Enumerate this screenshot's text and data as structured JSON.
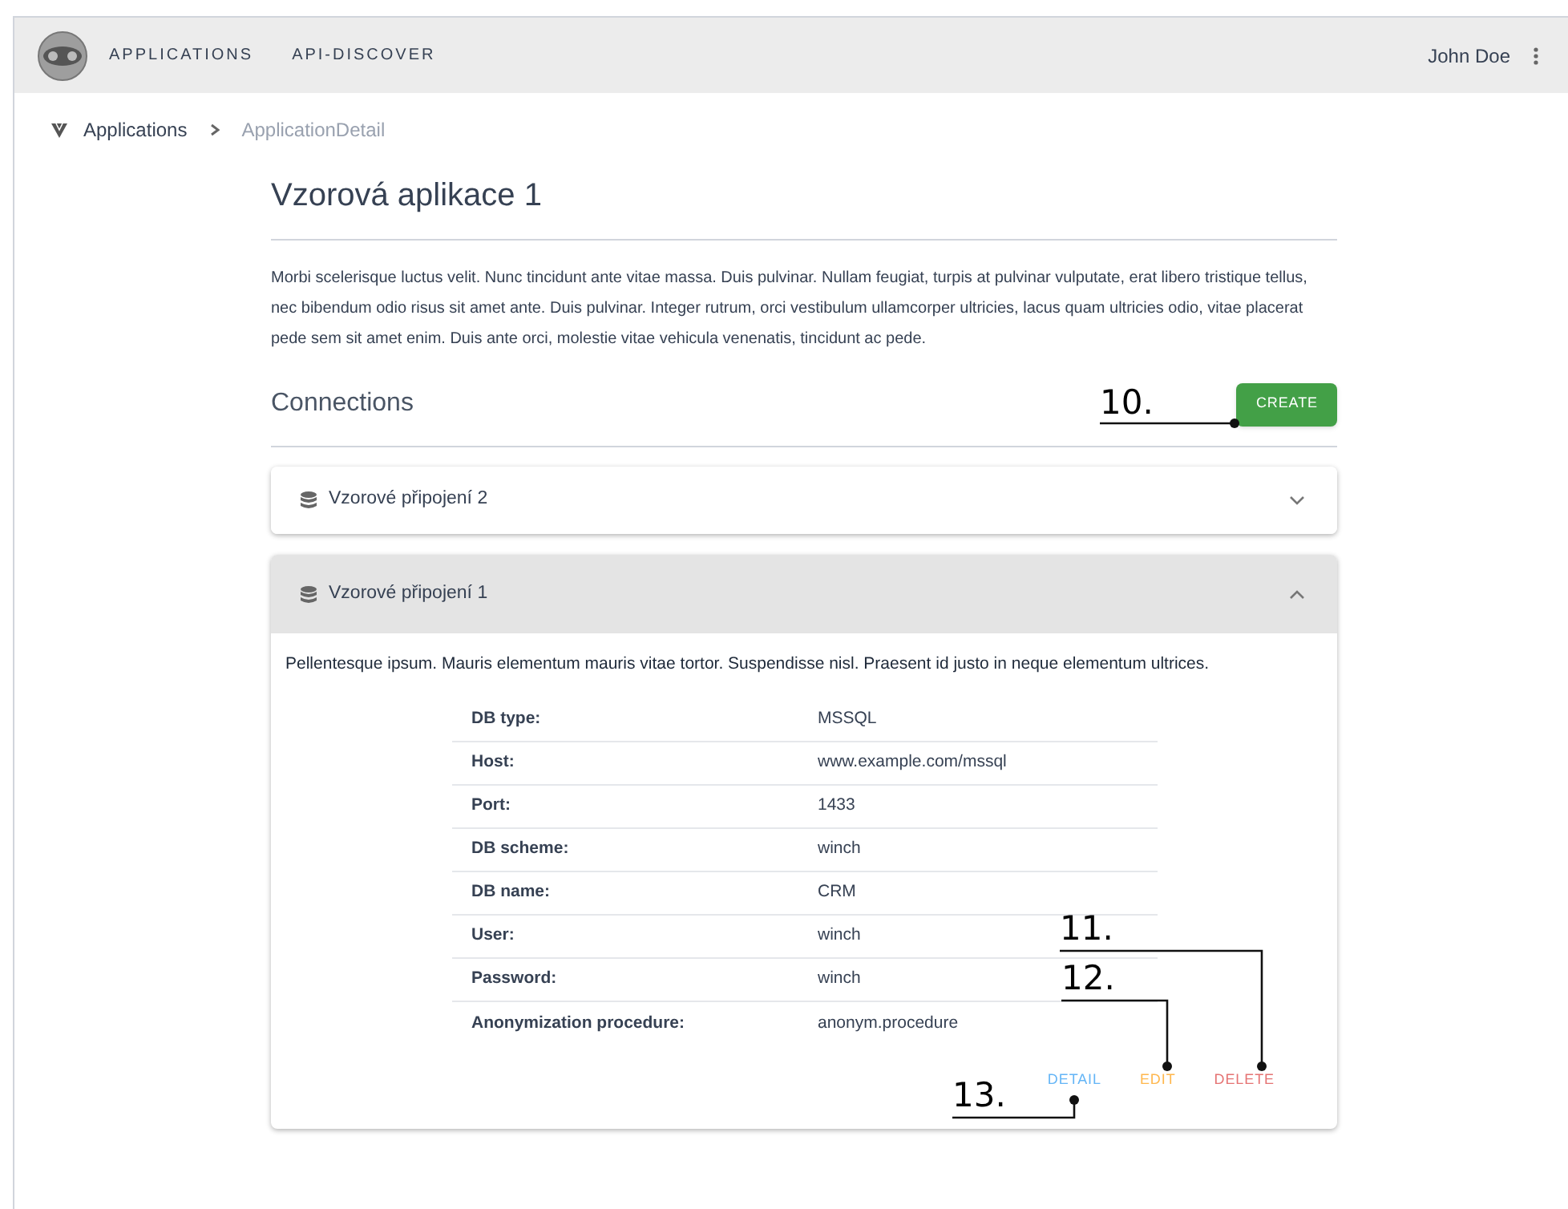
{
  "navbar": {
    "items": [
      {
        "label": "APPLICATIONS"
      },
      {
        "label": "API-DISCOVER"
      }
    ],
    "user": "John Doe"
  },
  "breadcrumb": [
    {
      "label": "Applications",
      "current": false
    },
    {
      "label": "ApplicationDetail",
      "current": true
    }
  ],
  "title": "Vzorová aplikace 1",
  "description": "Morbi scelerisque luctus velit. Nunc tincidunt ante vitae massa. Duis pulvinar. Nullam feugiat, turpis at pulvinar vulputate, erat libero tristique tellus, nec bibendum odio risus sit amet ante. Duis pulvinar. Integer rutrum, orci vestibulum ullamcorper ultricies, lacus quam ultricies odio, vitae placerat pede sem sit amet enim. Duis ante orci, molestie vitae vehicula venenatis, tincidunt ac pede.",
  "connections": {
    "heading": "Connections",
    "create_button": "CREATE",
    "panels": [
      {
        "name": "Vzorové připojení 2",
        "expanded": false
      },
      {
        "name": "Vzorové připojení 1",
        "expanded": true,
        "description": "Pellentesque ipsum. Mauris elementum mauris vitae tortor. Suspendisse nisl. Praesent id justo in neque elementum ultrices.",
        "details": [
          {
            "label": "DB type:",
            "value": "MSSQL"
          },
          {
            "label": "Host:",
            "value": "www.example.com/mssql"
          },
          {
            "label": "Port:",
            "value": "1433"
          },
          {
            "label": "DB scheme:",
            "value": "winch"
          },
          {
            "label": "DB name:",
            "value": "CRM"
          },
          {
            "label": "User:",
            "value": "winch"
          },
          {
            "label": "Password:",
            "value": "winch"
          },
          {
            "label": "Anonymization procedure:",
            "value": "anonym.procedure"
          }
        ],
        "actions": [
          {
            "label": "DETAIL",
            "color": "#64b5f6"
          },
          {
            "label": "EDIT",
            "color": "#ffb74d"
          },
          {
            "label": "DELETE",
            "color": "#e57373"
          }
        ]
      }
    ]
  },
  "callouts": [
    {
      "label": "10."
    },
    {
      "label": "11."
    },
    {
      "label": "12."
    },
    {
      "label": "13."
    }
  ]
}
